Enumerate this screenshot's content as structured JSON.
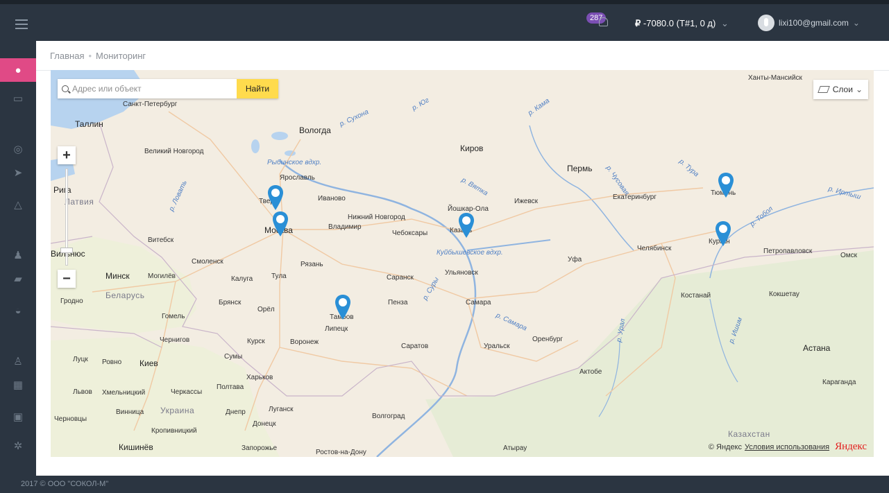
{
  "header": {
    "notifications_count": "287",
    "balance_symbol": "₽",
    "balance_text": "-7080.0 (Т#1, 0 д)",
    "user_email": "lixi100@gmail.com"
  },
  "breadcrumb": {
    "home": "Главная",
    "current": "Мониторинг"
  },
  "map": {
    "search_placeholder": "Адрес или объект",
    "search_button": "Найти",
    "layers_label": "Слои",
    "copyright": "© Яндекс",
    "terms_link": "Условия использования",
    "logo": "Яндекс",
    "cities": [
      "Ханты-Мансийск",
      "Санкт-Петербург",
      "Таллин",
      "Вологда",
      "Киров",
      "Великий Новгород",
      "Пермь",
      "Ярославль",
      "Тюмень",
      "Рига",
      "Латвия",
      "Тверь",
      "Иваново",
      "Ижевск",
      "Екатеринбург",
      "Йошкар-Ола",
      "Нижний Новгород",
      "Москва",
      "Владимир",
      "Чебоксары",
      "Казань",
      "Витебск",
      "Вильнюс",
      "Смоленск",
      "Рязань",
      "Челябинск",
      "Курган",
      "Петропавловск",
      "Омск",
      "Минск",
      "Могилёв",
      "Калуга",
      "Тула",
      "Саранск",
      "Ульяновск",
      "Уфа",
      "Беларусь",
      "Гродно",
      "Брянск",
      "Орёл",
      "Пенза",
      "Самара",
      "Костанай",
      "Кокшетау",
      "Гомель",
      "Тамбов",
      "Липецк",
      "Чернигов",
      "Курск",
      "Воронеж",
      "Саратов",
      "Уральск",
      "Оренбург",
      "Астана",
      "Луцк",
      "Ровно",
      "Киев",
      "Сумы",
      "Харьков",
      "Актобе",
      "Львов",
      "Хмельницкий",
      "Черкассы",
      "Полтава",
      "Караганда",
      "Украина",
      "Винница",
      "Днепр",
      "Луганск",
      "Волгоград",
      "Черновцы",
      "Донецк",
      "Кропивницкий",
      "Казахстан",
      "Кишинёв",
      "Запорожье",
      "Ростов-на-Дону",
      "Атырау"
    ],
    "rivers": [
      "р. Сухона",
      "р. Юг",
      "р. Кама",
      "Рыбинское вдхр.",
      "р. Ловать",
      "р. Вятка",
      "р. Чусовая",
      "р. Тура",
      "р. Иртыш",
      "р. Тобол",
      "Куйбышевское вдхр.",
      "р. Суры",
      "р. Самара",
      "р. Урал",
      "р. Ишим"
    ]
  },
  "footer": {
    "text": "2017 © ООО \"СОКОЛ-М\""
  }
}
